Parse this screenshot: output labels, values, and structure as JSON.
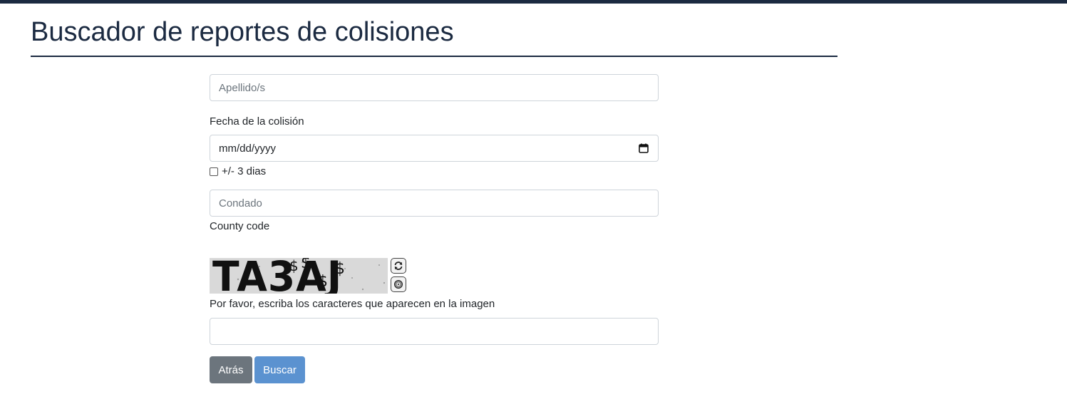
{
  "header": {
    "title": "Buscador de reportes de colisiones"
  },
  "form": {
    "lastname_placeholder": "Apellido/s",
    "date_label": "Fecha de la colisión",
    "date_placeholder": "mm/dd/yyyy",
    "range_checkbox_label": "+/- 3 dias",
    "county_placeholder": "Condado",
    "county_help": "County code",
    "captcha_text": "TA3AJ",
    "captcha_instruction": "Por favor, escriba los caracteres que aparecen en la imagen",
    "captcha_value": ""
  },
  "buttons": {
    "back_label": "Atrás",
    "search_label": "Buscar"
  },
  "colors": {
    "brand_dark": "#1b2a41",
    "secondary_button": "#6c757d",
    "primary_button": "#5b92d0"
  }
}
